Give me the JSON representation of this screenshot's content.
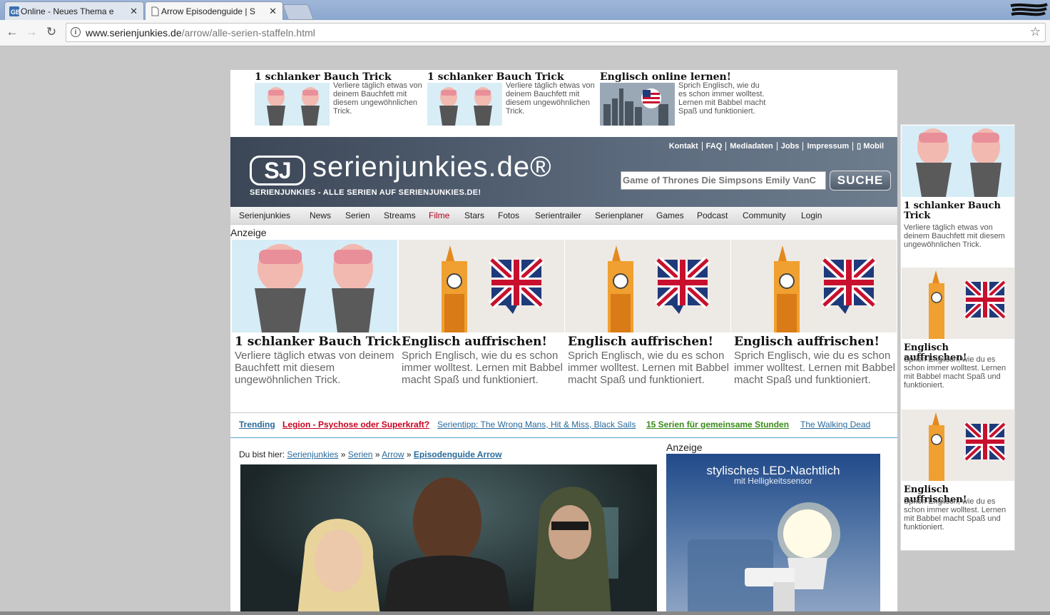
{
  "browser": {
    "tabs": [
      {
        "title": "Online - Neues Thema e",
        "active": false
      },
      {
        "title": "Arrow Episodenguide | S",
        "active": true
      }
    ],
    "url_host": "www.serienjunkies.de",
    "url_path": "/arrow/alle-serien-staffeln.html"
  },
  "top_ads": [
    {
      "title": "1 schlanker Bauch Trick",
      "text": "Verliere täglich etwas von deinem Bauchfett mit diesem ungewöhnlichen Trick.",
      "image": "belly"
    },
    {
      "title": "1 schlanker Bauch Trick",
      "text": "Verliere täglich etwas von deinem Bauchfett mit diesem ungewöhnlichen Trick.",
      "image": "belly"
    },
    {
      "title": "Englisch online lernen!",
      "text": "Sprich Englisch, wie du es schon immer wolltest. Lernen mit Babbel macht Spaß und funktioniert.",
      "image": "skyline"
    }
  ],
  "header": {
    "toplinks": [
      "Kontakt",
      "FAQ",
      "Mediadaten",
      "Jobs",
      "Impressum",
      "▯ Mobil"
    ],
    "logo_mark": "SJ",
    "logo_name": "serienjunkies.de®",
    "tagline": "SERIENJUNKIES - ALLE SERIEN AUF SERIENJUNKIES.DE!",
    "search_placeholder": "Game of Thrones Die Simpsons Emily VanC",
    "search_button": "SUCHE"
  },
  "nav": [
    "Serienjunkies",
    "News",
    "Serien",
    "Streams",
    "Filme",
    "Stars",
    "Fotos",
    "Serientrailer",
    "Serienplaner",
    "Games",
    "Podcast",
    "Community",
    "Login"
  ],
  "ad_label": "Anzeige",
  "big_ads": [
    {
      "title": "1 schlanker Bauch Trick",
      "text": "Verliere täglich etwas von deinem Bauchfett mit diesem ungewöhnlichen Trick.",
      "image": "belly"
    },
    {
      "title": "Englisch auffrischen!",
      "text": "Sprich Englisch, wie du es schon immer wolltest. Lernen mit Babbel macht Spaß und funktioniert.",
      "image": "bigben"
    },
    {
      "title": "Englisch auffrischen!",
      "text": "Sprich Englisch, wie du es schon immer wolltest. Lernen mit Babbel macht Spaß und funktioniert.",
      "image": "bigben"
    },
    {
      "title": "Englisch auffrischen!",
      "text": "Sprich Englisch, wie du es schon immer wolltest. Lernen mit Babbel macht Spaß und funktioniert.",
      "image": "bigben"
    }
  ],
  "trending": [
    {
      "label": "Trending",
      "color": "#2a6a9a"
    },
    {
      "label": "Legion - Psychose oder Superkraft?",
      "color": "#c8001e"
    },
    {
      "label": "Serientipp: The Wrong Mans, Hit & Miss, Black Sails",
      "color": "#2a6a9a"
    },
    {
      "label": "15 Serien für gemeinsame Stunden",
      "color": "#3a8a1a"
    },
    {
      "label": "The Walking Dead",
      "color": "#2a6a9a"
    }
  ],
  "breadcrumb": {
    "prefix": "Du bist hier:",
    "items": [
      "Serienjunkies",
      "Serien",
      "Arrow",
      "Episodenguide Arrow"
    ],
    "sep": "»"
  },
  "side_ad": {
    "title": "stylisches LED-Nachtlich",
    "subtitle": "mit Helligkeitssensor"
  },
  "right_ads": [
    {
      "title": "1 schlanker Bauch Trick",
      "text": "Verliere täglich etwas von deinem Bauchfett mit diesem ungewöhnlichen Trick.",
      "image": "belly"
    },
    {
      "title": "Englisch auffrischen!",
      "text": "Sprich Englisch, wie du es schon immer wolltest. Lernen mit Babbel macht Spaß und funktioniert.",
      "image": "bigben"
    },
    {
      "title": "Englisch auffrischen!",
      "text": "Sprich Englisch, wie du es schon immer wolltest. Lernen mit Babbel macht Spaß und funktioniert.",
      "image": "bigben"
    }
  ]
}
